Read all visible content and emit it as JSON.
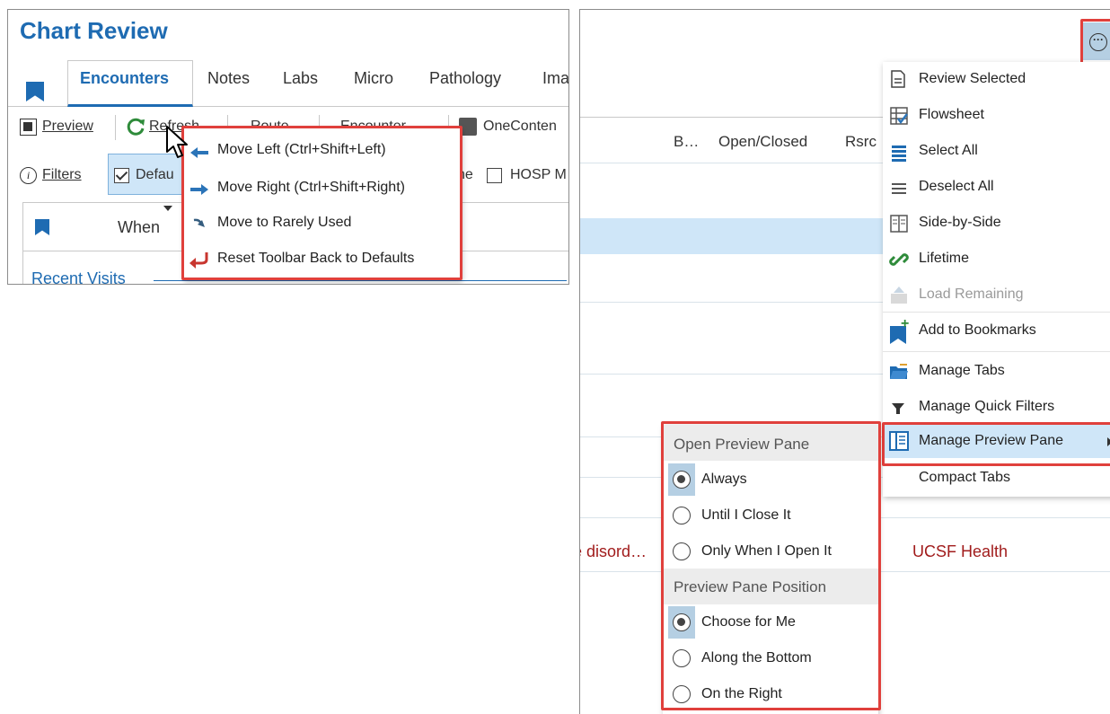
{
  "left": {
    "title": "Chart Review",
    "tabs": [
      "Encounters",
      "Notes",
      "Labs",
      "Micro",
      "Pathology",
      "Ima"
    ],
    "toolbar": {
      "preview": "Preview",
      "refresh": "Refresh",
      "route": "Route",
      "encounter": "Encounter",
      "onecontent": "OneConten"
    },
    "filters_row": {
      "filters": "Filters",
      "default": "Defau",
      "partial": "ne",
      "hosp": "HOSP M"
    },
    "grid": {
      "when_header": "When",
      "recent_visits": "Recent Visits"
    },
    "context_menu": [
      {
        "label": "Move Left (Ctrl+Shift+Left)",
        "icon": "arrow-left-icon"
      },
      {
        "label": "Move Right (Ctrl+Shift+Right)",
        "icon": "arrow-right-icon"
      },
      {
        "label": "Move to Rarely Used",
        "icon": "arrow-down-right-icon"
      },
      {
        "label": "Reset Toolbar Back to Defaults",
        "icon": "undo-icon"
      }
    ]
  },
  "right": {
    "columns": {
      "b": "B…",
      "open_closed": "Open/Closed",
      "rsrc": "Rsrc"
    },
    "row_texts": {
      "disorder": "e disord…",
      "org": "UCSF Health"
    },
    "more_menu": {
      "review_selected": "Review Selected",
      "flowsheet": "Flowsheet",
      "select_all": "Select All",
      "deselect_all": "Deselect All",
      "side_by_side": "Side-by-Side",
      "lifetime": "Lifetime",
      "load_remaining": "Load Remaining",
      "add_bookmarks": "Add to Bookmarks",
      "manage_tabs": "Manage Tabs",
      "manage_quick_filters": "Manage Quick Filters",
      "manage_preview_pane": "Manage Preview Pane",
      "compact_tabs": "Compact Tabs"
    },
    "submenu": {
      "open_header": "Open Preview Pane",
      "always": "Always",
      "until_close": "Until I Close It",
      "only_when_open": "Only When I Open It",
      "position_header": "Preview Pane Position",
      "choose_for_me": "Choose for Me",
      "along_bottom": "Along the Bottom",
      "on_right": "On the Right"
    }
  },
  "colors": {
    "accent": "#1e6bb2",
    "highlight": "#e0403c",
    "selection": "#cfe6f8"
  }
}
